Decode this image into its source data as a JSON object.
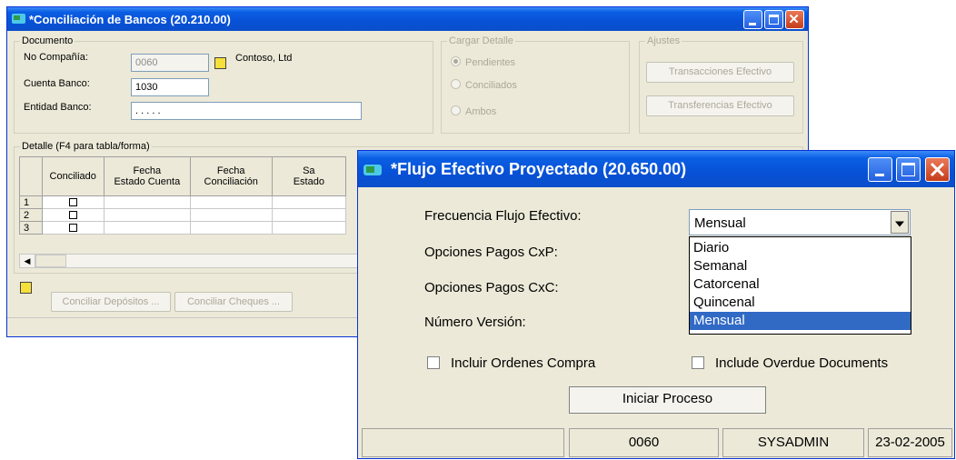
{
  "win1": {
    "title": "*Conciliación de Bancos (20.210.00)",
    "documento": {
      "label": "Documento",
      "no_compania_label": "No Compañía:",
      "no_compania_value": "0060",
      "company_name": "Contoso, Ltd",
      "cuenta_banco_label": "Cuenta Banco:",
      "cuenta_banco_value": "1030",
      "entidad_banco_label": "Entidad Banco:",
      "entidad_banco_value": ". . . . ."
    },
    "cargar": {
      "label": "Cargar Detalle",
      "options": [
        "Pendientes",
        "Conciliados",
        "Ambos"
      ]
    },
    "ajustes": {
      "label": "Ajustes",
      "btn1": "Transacciones Efectivo",
      "btn2": "Transferencias Efectivo"
    },
    "detalle": {
      "label": "Detalle (F4 para tabla/forma)",
      "headers": [
        "Conciliado",
        "Fecha\nEstado Cuenta",
        "Fecha\nConciliación",
        "Sa\nEstado"
      ],
      "rows": [
        "1",
        "2",
        "3"
      ]
    },
    "conciliar_depositos": "Conciliar Depósitos ...",
    "conciliar_cheques": "Conciliar Cheques ..."
  },
  "win2": {
    "title": "*Flujo Efectivo Proyectado (20.650.00)",
    "frecuencia_label": "Frecuencia Flujo Efectivo:",
    "frecuencia_value": "Mensual",
    "pagos_cxp_label": "Opciones Pagos CxP:",
    "pagos_cxc_label": "Opciones Pagos CxC:",
    "numero_version_label": "Número Versión:",
    "dropdown_options": [
      "Diario",
      "Semanal",
      "Catorcenal",
      "Quincenal",
      "Mensual"
    ],
    "dropdown_selected_index": 4,
    "incluir_ordenes": "Incluir Ordenes Compra",
    "include_overdue": "Include Overdue Documents",
    "iniciar_proceso": "Iniciar Proceso",
    "status": [
      "",
      "0060",
      "SYSADMIN",
      "23-02-2005"
    ]
  },
  "colors": {
    "titlebar": "#0a5fe3",
    "selection": "#316ac5",
    "window_bg": "#ece9d8"
  },
  "icons": [
    "app-icon",
    "minimize-icon",
    "maximize-icon",
    "close-icon",
    "dropdown-arrow-icon",
    "lookup-icon"
  ]
}
